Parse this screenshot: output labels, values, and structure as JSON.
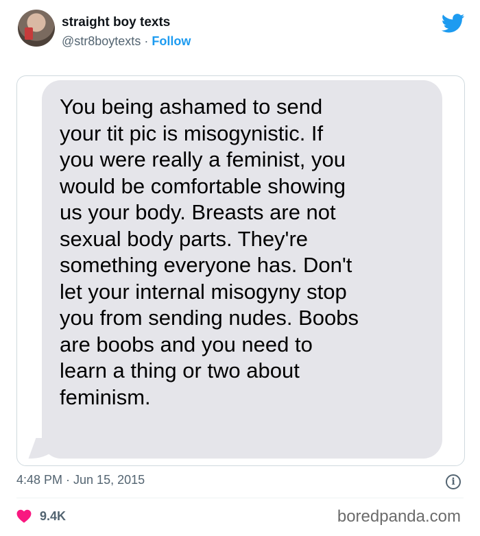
{
  "tweet": {
    "display_name": "straight boy texts",
    "handle": "@str8boytexts",
    "separator": "·",
    "follow_label": "Follow",
    "timestamp": "4:48 PM · Jun 15, 2015",
    "like_count": "9.4K",
    "info_glyph": "i"
  },
  "message": {
    "lines": [
      "You being ashamed to send",
      "your tit pic is misogynistic. If",
      "you were really a feminist, you",
      "would be comfortable showing",
      "us your body. Breasts are not",
      "sexual body parts. They're",
      "something everyone has. Don't",
      "let your internal misogyny stop",
      "you from sending nudes. Boobs",
      "are boobs and you need to",
      "learn a thing or two about",
      "feminism."
    ]
  },
  "watermark": "boredpanda.com",
  "colors": {
    "accent": "#1d9bf0",
    "heart": "#f91880",
    "bubble": "#e5e5ea",
    "secondary_text": "#536471"
  },
  "icons": {
    "brand": "twitter-bird-icon",
    "like": "heart-icon",
    "info": "info-icon"
  }
}
